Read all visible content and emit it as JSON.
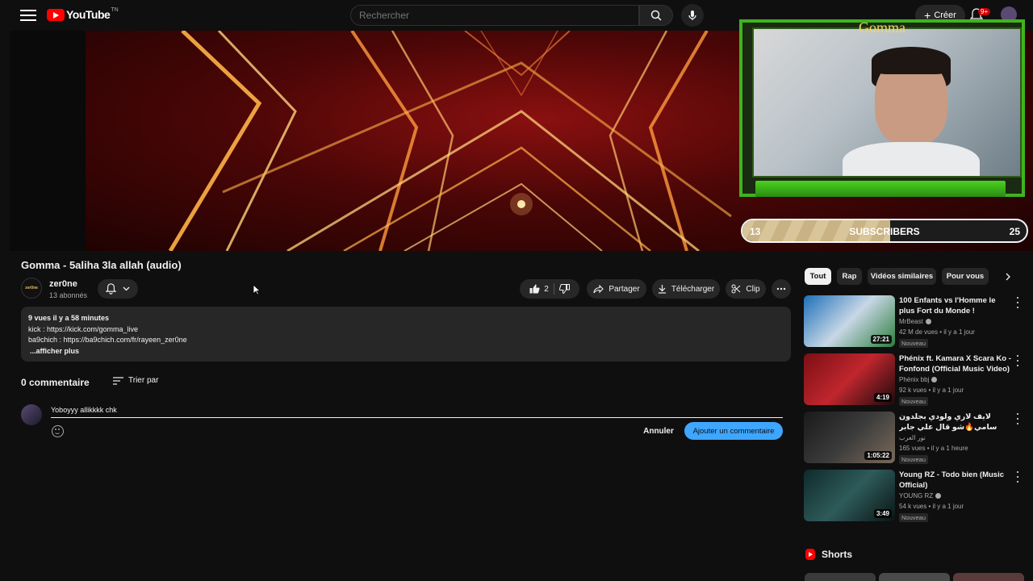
{
  "header": {
    "logo_text": "YouTube",
    "logo_tm": "TN",
    "search_placeholder": "Rechercher",
    "create_label": "Créer",
    "notifications_count": "9+"
  },
  "player": {
    "stream_overlay_name": "Gomma",
    "subscribers_bar": {
      "label": "SUBSCRIBERS",
      "current": "13",
      "goal": "25",
      "progress_fraction": 0.52
    }
  },
  "video": {
    "title": "Gomma - 5aliha 3la allah (audio)",
    "channel_name": "zer0ne",
    "channel_avatar_text": "zer0ne",
    "channel_subscribers": "13 abonnés",
    "like_count": "2",
    "share_label": "Partager",
    "download_label": "Télécharger",
    "clip_label": "Clip"
  },
  "description": {
    "meta": "9 vues  il y a 58 minutes",
    "line1": "kick : https://kick.com/gomma_live",
    "line2": "ba9chich : https://ba9chich.com/fr/rayeen_zer0ne",
    "more": "...afficher plus"
  },
  "comments": {
    "count_label": "0 commentaire",
    "sort_label": "Trier par",
    "input_value": "Yoboyyy allikkkk chk",
    "cancel_label": "Annuler",
    "submit_label": "Ajouter un commentaire"
  },
  "sidebar": {
    "chips": [
      "Tout",
      "Rap",
      "Vidéos similaires",
      "Pour vous"
    ],
    "recommendations": [
      {
        "title": "100 Enfants vs l'Homme le plus Fort du Monde !",
        "channel": "MrBeast",
        "verified": true,
        "stats": "42 M de vues • il y a 1 jour",
        "badge": "Nouveau",
        "duration": "27:21",
        "thumb_colors": [
          "#1d6fb8",
          "#c8d7e6",
          "#2b7d3d"
        ]
      },
      {
        "title": "Phénix ft. Kamara X Scara Ko - Fonfond (Official Music Video)",
        "channel": "Phénix bbj",
        "verified": true,
        "stats": "92 k vues • il y a 1 jour",
        "badge": "Nouveau",
        "duration": "4:19",
        "thumb_colors": [
          "#7a0f14",
          "#c0262e",
          "#1a0a0a"
        ]
      },
      {
        "title": "لايف لاري ولودي بجلدون سامي🔥شو قال علي جابر #قصة_وصيب explore#",
        "channel": "نور العرب",
        "verified": false,
        "stats": "165 vues • il y a 1 heure",
        "badge": "Nouveau",
        "duration": "1:05:22",
        "thumb_colors": [
          "#1a1a1a",
          "#3b3b3b",
          "#7a6a5a"
        ]
      },
      {
        "title": "Young RZ - Todo bien (Music Official)",
        "channel": "YOUNG RZ",
        "verified": true,
        "stats": "54 k vues • il y a 1 jour",
        "badge": "Nouveau",
        "duration": "3:49",
        "thumb_colors": [
          "#0f2a2a",
          "#2e5b5a",
          "#0a1414"
        ]
      }
    ],
    "shorts_label": "Shorts"
  }
}
